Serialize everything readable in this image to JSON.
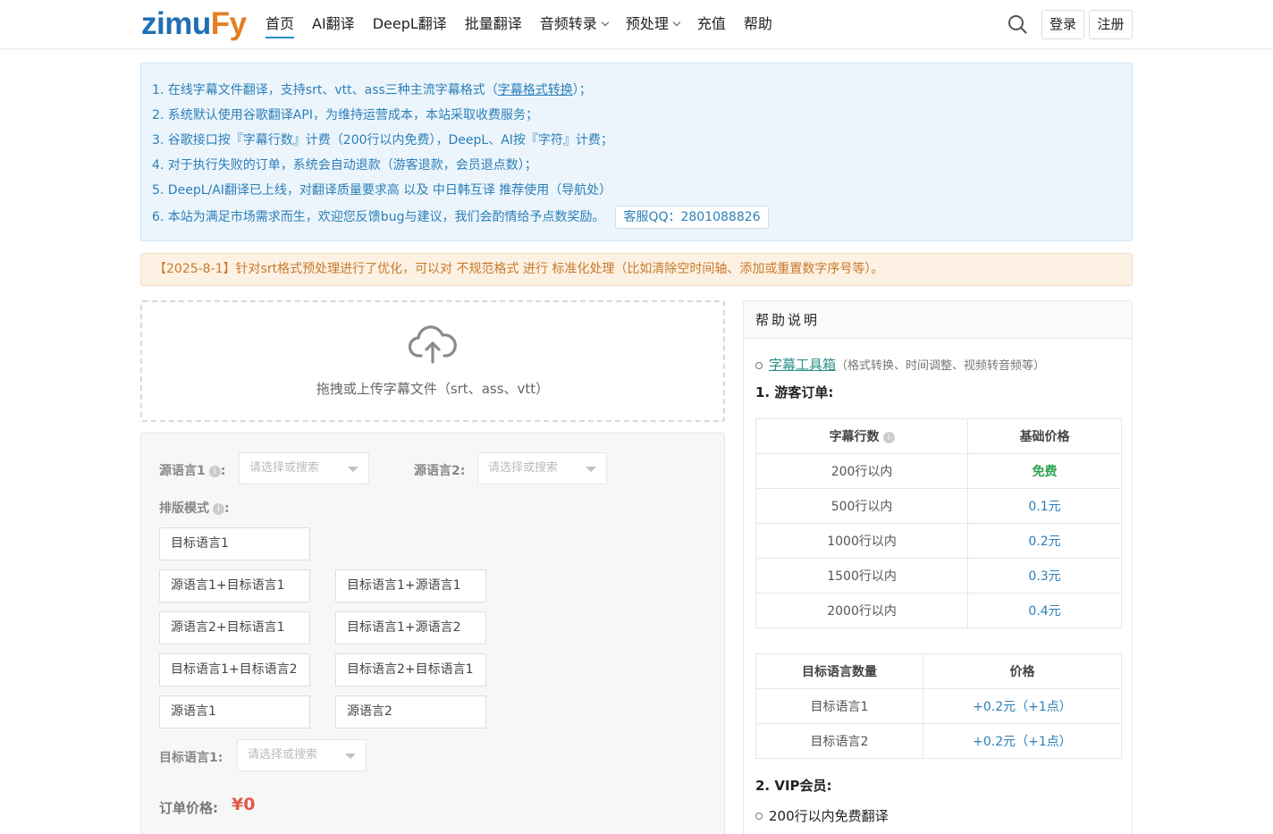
{
  "header": {
    "logo_part1": "zimu",
    "logo_part2": "Fy",
    "nav": [
      {
        "label": "首页",
        "active": true,
        "dropdown": false
      },
      {
        "label": "AI翻译",
        "active": false,
        "dropdown": false
      },
      {
        "label": "DeepL翻译",
        "active": false,
        "dropdown": false
      },
      {
        "label": "批量翻译",
        "active": false,
        "dropdown": false
      },
      {
        "label": "音频转录",
        "active": false,
        "dropdown": true
      },
      {
        "label": "预处理",
        "active": false,
        "dropdown": true
      },
      {
        "label": "充值",
        "active": false,
        "dropdown": false
      },
      {
        "label": "帮助",
        "active": false,
        "dropdown": false
      }
    ],
    "login": "登录",
    "register": "注册"
  },
  "notice": {
    "line1_prefix": "1. 在线字幕文件翻译，支持srt、vtt、ass三种主流字幕格式（",
    "line1_link": "字幕格式转换",
    "line1_suffix": "）；",
    "line2": "2. 系统默认使用谷歌翻译API，为维持运营成本，本站采取收费服务；",
    "line3": "3. 谷歌接口按『字幕行数』计费（200行以内免费），DeepL、AI按『字符』计费；",
    "line4": "4. 对于执行失败的订单，系统会自动退款（游客退款，会员退点数）；",
    "line5": "5. DeepL/AI翻译已上线，对翻译质量要求高 以及 中日韩互译 推荐使用（导航处）",
    "line6": "6. 本站为满足市场需求而生，欢迎您反馈bug与建议，我们会酌情给予点数奖励。",
    "qq": "客服QQ：2801088826"
  },
  "announcement": "【2025-8-1】针对srt格式预处理进行了优化，可以对 不规范格式 进行 标准化处理（比如清除空时间轴、添加或重置数字序号等）。",
  "upload": {
    "text": "拖拽或上传字幕文件（srt、ass、vtt）",
    "icon": "cloud-upload-icon"
  },
  "form": {
    "source1_label": "源语言1",
    "source2_label": "源语言2",
    "colon": ":",
    "select_placeholder": "请选择或搜索",
    "layout_label": "排版模式",
    "modes": [
      "目标语言1",
      "源语言1+目标语言1",
      "目标语言1+源语言1",
      "源语言2+目标语言1",
      "目标语言1+源语言2",
      "目标语言1+目标语言2",
      "目标语言2+目标语言1",
      "源语言1",
      "源语言2"
    ],
    "target1_label": "目标语言1",
    "price_label": "订单价格:",
    "price_value": "¥0"
  },
  "help": {
    "title": "帮助说明",
    "tool_link": "字幕工具箱",
    "tool_desc": "（格式转换、时间调整、视频转音频等）",
    "section1": "1. 游客订单:",
    "table1": {
      "headers": [
        "字幕行数",
        "基础价格"
      ],
      "rows": [
        [
          "200行以内",
          "免费"
        ],
        [
          "500行以内",
          "0.1元"
        ],
        [
          "1000行以内",
          "0.2元"
        ],
        [
          "1500行以内",
          "0.3元"
        ],
        [
          "2000行以内",
          "0.4元"
        ]
      ]
    },
    "table2": {
      "headers": [
        "目标语言数量",
        "价格"
      ],
      "rows": [
        [
          "目标语言1",
          "+0.2元（+1点）"
        ],
        [
          "目标语言2",
          "+0.2元（+1点）"
        ]
      ]
    },
    "section2": "2. VIP会员:",
    "vip_line1": "200行以内免费翻译"
  },
  "colors": {
    "brand_blue": "#1f6fb4",
    "brand_orange": "#e67e22",
    "notice_text": "#2b7fb8",
    "announce_text": "#c77a2c",
    "price_red": "#e05b4b",
    "free_green": "#2ea44f"
  }
}
